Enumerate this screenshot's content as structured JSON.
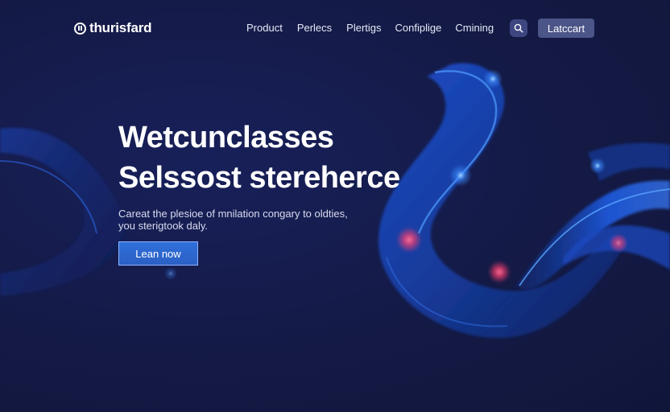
{
  "header": {
    "logo_text": "thurisfard",
    "nav": [
      "Product",
      "Perlecs",
      "Plertigs",
      "Confiplige",
      "Cmining"
    ],
    "cta_label": "Latccart"
  },
  "hero": {
    "title_lines": [
      "Wetcunclasses",
      "Selssost stereherce"
    ],
    "subtitle_lines": [
      "Careat the plesioe of mnilation congary to oldties,",
      "you sterigtook daly."
    ],
    "button_label": "Lean now"
  },
  "colors": {
    "background": "#141b45",
    "accent_blue": "#2f6fdb",
    "glow_pink": "#ff4f7a"
  },
  "icons": {
    "search": "search-icon",
    "logo": "logo-icon"
  }
}
